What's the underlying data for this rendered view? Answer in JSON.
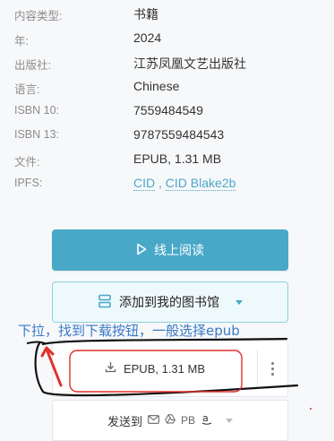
{
  "details": [
    {
      "label": "内容类型:",
      "value": "书籍"
    },
    {
      "label": "年:",
      "value": "2024"
    },
    {
      "label": "出版社:",
      "value": "江苏凤凰文艺出版社"
    },
    {
      "label": "语言:",
      "value": "Chinese"
    },
    {
      "label": "ISBN 10:",
      "value": "7559484549"
    },
    {
      "label": "ISBN 13:",
      "value": "9787559484543"
    },
    {
      "label": "文件:",
      "value": "EPUB, 1.31 MB"
    }
  ],
  "ipfs": {
    "label": "IPFS:",
    "link1": "CID",
    "separator": ",",
    "link2": "CID Blake2b"
  },
  "actions": {
    "read_online": "线上阅读",
    "add_to_library": "添加到我的图书馆",
    "download_label": "EPUB, 1.31 MB",
    "send_to": "发送到",
    "send_pb": "PB"
  },
  "annotation": {
    "hint_text": "下拉，找到下载按钮，一般选择epub"
  },
  "colors": {
    "accent": "#49a8c8",
    "annotation_red": "#e0302a",
    "annotation_blue": "#3a79c9"
  }
}
